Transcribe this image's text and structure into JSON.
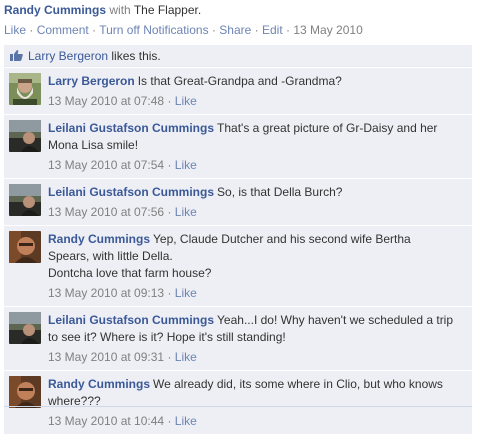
{
  "post": {
    "author": "Randy Cummings",
    "with_text": "with",
    "tagged": "The Flapper.",
    "actions": {
      "like": "Like",
      "comment": "Comment",
      "notifications": "Turn off Notifications",
      "share": "Share",
      "edit": "Edit",
      "separator": "·",
      "date": "13 May 2010"
    },
    "likes": {
      "name": "Larry Bergeron",
      "text": "likes this."
    }
  },
  "comments": [
    {
      "author": "Larry Bergeron",
      "avatar": "avatar-larry",
      "lines": [
        "Is that Great-Grandpa and -Grandma?"
      ],
      "time": "13 May 2010 at 07:48",
      "like": "Like"
    },
    {
      "author": "Leilani Gustafson Cummings",
      "avatar": "avatar-leilani",
      "lines": [
        "That's a great picture of Gr-Daisy and her",
        "Mona Lisa smile!"
      ],
      "time": "13 May 2010 at 07:54",
      "like": "Like"
    },
    {
      "author": "Leilani Gustafson Cummings",
      "avatar": "avatar-leilani",
      "lines": [
        "So, is that Della Burch?"
      ],
      "time": "13 May 2010 at 07:56",
      "like": "Like"
    },
    {
      "author": "Randy Cummings",
      "avatar": "avatar-randy",
      "lines": [
        "Yep, Claude Dutcher and his second wife Bertha",
        "Spears, with little Della.",
        "Dontcha love that farm house?"
      ],
      "time": "13 May 2010 at 09:13",
      "like": "Like"
    },
    {
      "author": "Leilani Gustafson Cummings",
      "avatar": "avatar-leilani",
      "lines": [
        "Yeah...I do! Why haven't we scheduled a trip",
        "to see it? Where is it? Hope it's still standing!"
      ],
      "time": "13 May 2010 at 09:31",
      "like": "Like"
    },
    {
      "author": "Randy Cummings",
      "avatar": "avatar-randy",
      "lines": [
        "We already did, its some where in Clio, but who knows",
        "where???"
      ],
      "time": "13 May 2010 at 10:44",
      "like": "Like"
    }
  ]
}
